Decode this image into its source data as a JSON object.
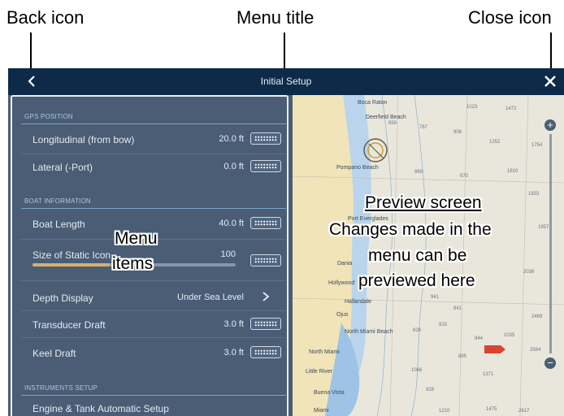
{
  "callouts": {
    "back": "Back icon",
    "title": "Menu title",
    "close": "Close icon"
  },
  "titlebar": {
    "title": "Initial Setup"
  },
  "sections": {
    "gps": "GPS POSITION",
    "boat": "BOAT INFORMATION",
    "instruments": "INSTRUMENTS SETUP"
  },
  "rows": {
    "longitudinal": {
      "label": "Longitudinal (from bow)",
      "value": "20.0 ft"
    },
    "lateral": {
      "label": "Lateral (-Port)",
      "value": "0.0 ft"
    },
    "boat_length": {
      "label": "Boat Length",
      "value": "40.0 ft"
    },
    "static_icon": {
      "label": "Size of Static Icon",
      "value": "100",
      "slider_fraction": 0.38
    },
    "depth_display": {
      "label": "Depth Display",
      "value": "Under Sea Level"
    },
    "transducer": {
      "label": "Transducer Draft",
      "value": "3.0 ft"
    },
    "keel": {
      "label": "Keel Draft",
      "value": "3.0 ft"
    },
    "engine": {
      "label": "Engine & Tank Automatic Setup"
    }
  },
  "overlays": {
    "menu_items_line1": "Menu",
    "menu_items_line2": "items",
    "preview_heading": "Preview screen",
    "preview_line1": "Changes made in the",
    "preview_line2": "menu can be",
    "preview_line3": "previewed here"
  },
  "chart": {
    "places": [
      "Boca Raton",
      "Deerfield Beach",
      "Pompano Beach",
      "Port Everglades",
      "Dania",
      "Hollywood",
      "Hallandale",
      "Ojus",
      "North Miami Beach",
      "North Miami",
      "Little River",
      "Buena Vista",
      "Miami"
    ],
    "depths": [
      "1023",
      "1472",
      "659",
      "767",
      "908",
      "1252",
      "1754",
      "869",
      "970",
      "1810",
      "1833",
      "1957",
      "2036",
      "941",
      "841",
      "2469",
      "826",
      "915",
      "944",
      "1035",
      "2584",
      "885",
      "1066",
      "928",
      "1210",
      "1371",
      "1475",
      "2617"
    ],
    "zoom_in": "+",
    "zoom_out": "−"
  },
  "colors": {
    "titlebar": "#0d2a48",
    "menu_bg": "#4a5d74",
    "section_text": "#a9c8e3",
    "slider_fill": "#d9b067",
    "chart_bg": "#e9e7dc",
    "land": "#f0e4b8",
    "shallow_water": "#9fc3e6"
  },
  "icons": {
    "back": "chevron-left-icon",
    "close": "close-x-icon",
    "keyboard": "keyboard-icon",
    "chevron": "chevron-right-icon"
  }
}
